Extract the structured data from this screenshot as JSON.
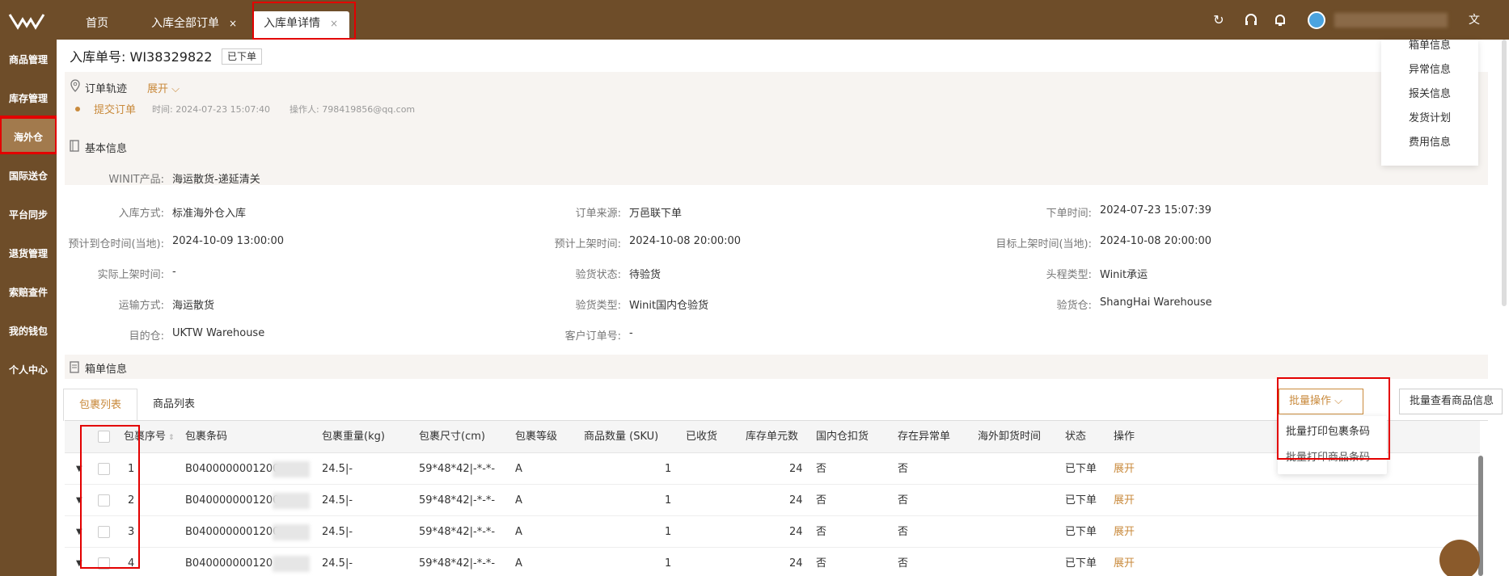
{
  "tabs": [
    {
      "label": "首页"
    },
    {
      "label": "入库全部订单",
      "close": "×"
    },
    {
      "label": "入库单详情",
      "close": "×"
    }
  ],
  "sidebar": {
    "items": [
      {
        "label": "商品管理"
      },
      {
        "label": "库存管理"
      },
      {
        "label": "海外仓"
      },
      {
        "label": "国际送仓"
      },
      {
        "label": "平台同步"
      },
      {
        "label": "退货管理"
      },
      {
        "label": "索赔查件"
      },
      {
        "label": "我的钱包"
      },
      {
        "label": "个人中心"
      }
    ]
  },
  "order": {
    "title_prefix": "入库单号:",
    "number": "WI38329822",
    "status": "已下单"
  },
  "track": {
    "title": "订单轨迹",
    "expand": "展开",
    "event": "提交订单",
    "time": "时间: 2024-07-23 15:07:40",
    "operator": "操作人: 798419856@qq.com"
  },
  "basic": {
    "title": "基本信息",
    "product_label": "WINIT产品:",
    "product": "海运散货-递延清关",
    "fields": [
      {
        "l": "入库方式:",
        "v": "标准海外仓入库"
      },
      {
        "l": "订单来源:",
        "v": "万邑联下单"
      },
      {
        "l": "下单时间:",
        "v": "2024-07-23 15:07:39"
      },
      {
        "l": "预计到仓时间(当地):",
        "v": "2024-10-09 13:00:00"
      },
      {
        "l": "预计上架时间:",
        "v": "2024-10-08 20:00:00"
      },
      {
        "l": "目标上架时间(当地):",
        "v": "2024-10-08 20:00:00"
      },
      {
        "l": "实际上架时间:",
        "v": "-"
      },
      {
        "l": "验货状态:",
        "v": "待验货"
      },
      {
        "l": "头程类型:",
        "v": "Winit承运"
      },
      {
        "l": "运输方式:",
        "v": "海运散货"
      },
      {
        "l": "验货类型:",
        "v": "Winit国内仓验货"
      },
      {
        "l": "验货仓:",
        "v": "ShangHai Warehouse"
      },
      {
        "l": "目的仓:",
        "v": "UKTW Warehouse"
      },
      {
        "l": "客户订单号:",
        "v": "-"
      }
    ]
  },
  "box": {
    "title": "箱单信息",
    "tabs": [
      "包裹列表",
      "商品列表"
    ],
    "bulk_btn": "批量操作",
    "view_btn": "批量查看商品信息",
    "menu": [
      "批量打印包裹条码",
      "批量打印商品条码"
    ],
    "columns": [
      "包裹序号",
      "包裹条码",
      "包裹重量(kg)",
      "包裹尺寸(cm)",
      "包裹等级",
      "商品数量 (SKU)",
      "已收货",
      "库存单元数",
      "国内仓扣货",
      "存在异常单",
      "海外卸货时间",
      "状态",
      "操作"
    ],
    "rows": [
      {
        "no": "1",
        "code": "B0400000001200",
        "w": "24.5|-",
        "size": "59*48*42|-*-*-",
        "grade": "A",
        "qty": "1",
        "units": "24",
        "hold": "否",
        "abn": "否",
        "status": "已下单",
        "op": "展开"
      },
      {
        "no": "2",
        "code": "B0400000001200",
        "w": "24.5|-",
        "size": "59*48*42|-*-*-",
        "grade": "A",
        "qty": "1",
        "units": "24",
        "hold": "否",
        "abn": "否",
        "status": "已下单",
        "op": "展开"
      },
      {
        "no": "3",
        "code": "B0400000001200",
        "w": "24.5|-",
        "size": "59*48*42|-*-*-",
        "grade": "A",
        "qty": "1",
        "units": "24",
        "hold": "否",
        "abn": "否",
        "status": "已下单",
        "op": "展开"
      },
      {
        "no": "4",
        "code": "B040000000120",
        "w": "24.5|-",
        "size": "59*48*42|-*-*-",
        "grade": "A",
        "qty": "1",
        "units": "24",
        "hold": "否",
        "abn": "否",
        "status": "已下单",
        "op": "展开"
      }
    ]
  },
  "anchor": [
    "箱单信息",
    "异常信息",
    "报关信息",
    "发货计划",
    "费用信息"
  ],
  "colors": {
    "brand": "#6e4d29",
    "accent": "#c98a3c",
    "highlight": "#e30000"
  },
  "icons": [
    "refresh-icon",
    "headset-icon",
    "bell-icon",
    "avatar",
    "translate-icon",
    "chevron-down-icon",
    "location-icon",
    "book-icon",
    "list-icon",
    "sort-icon",
    "caret-down-icon",
    "support-icon"
  ]
}
